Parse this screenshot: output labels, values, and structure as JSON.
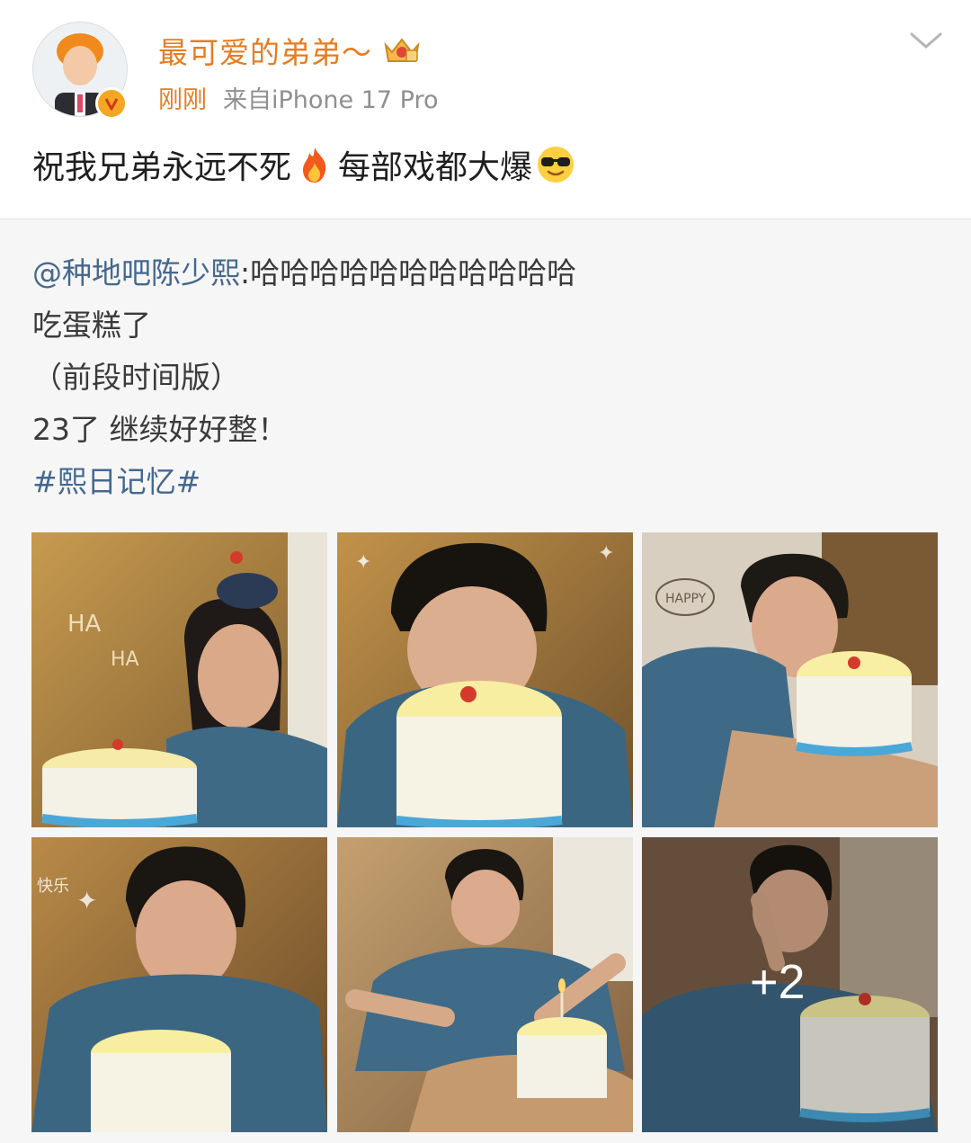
{
  "author": {
    "name": "最可爱的弟弟～",
    "avatar_icon": "avatar-orange-hair",
    "badge_icon": "verified-v-icon",
    "level_icon": "crown-vip-icon"
  },
  "meta": {
    "time": "刚刚",
    "source": "来自iPhone 17 Pro"
  },
  "post": {
    "text_part1": "祝我兄弟永远不死",
    "text_part2": "每部戏都大爆",
    "emoji1": "fire-emoji",
    "emoji2": "sunglasses-emoji"
  },
  "repost": {
    "mention": "@种地吧陈少熙",
    "line1_rest": ":哈哈哈哈哈哈哈哈哈哈哈",
    "line2": "吃蛋糕了",
    "line3": "（前段时间版）",
    "line4": "23了 继续好好整！",
    "hashtag": "#熙日记忆#"
  },
  "photos": {
    "count": 6,
    "more_label": "+2"
  },
  "colors": {
    "accent_orange": "#e77c21",
    "link_blue": "#44688f",
    "gray_text": "#8f8f8f"
  }
}
